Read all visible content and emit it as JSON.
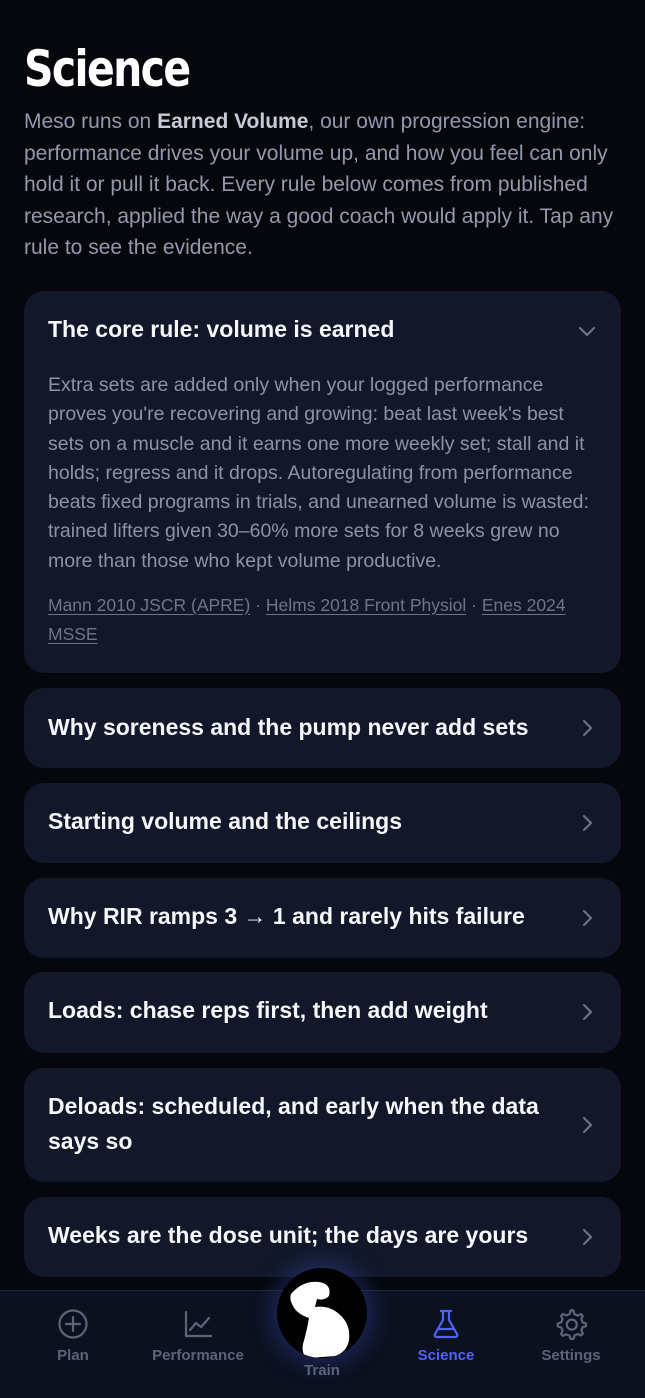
{
  "page": {
    "title": "Science",
    "intro_prefix": "Meso runs on ",
    "intro_bold": "Earned Volume",
    "intro_suffix": ", our own progression engine: performance drives your volume up, and how you feel can only hold it or pull it back. Every rule below comes from published research, applied the way a good coach would apply it. Tap any rule to see the evidence."
  },
  "core_rule": {
    "title": "The core rule: volume is earned",
    "expanded": true,
    "body": "Extra sets are added only when your logged performance proves you're recovering and growing: beat last week's best sets on a muscle and it earns one more weekly set; stall and it holds; regress and it drops. Autoregulating from performance beats fixed programs in trials, and unearned volume is wasted: trained lifters given 30–60% more sets for 8 weeks grew no more than those who kept volume productive.",
    "refs": [
      "Mann 2010 JSCR (APRE)",
      "Helms 2018 Front Physiol",
      "Enes 2024 MSSE"
    ],
    "ref_separator": "·"
  },
  "rules": [
    {
      "title": "Why soreness and the pump never add sets"
    },
    {
      "title": "Starting volume and the ceilings"
    },
    {
      "title": "Why RIR ramps 3 → 1 and rarely hits failure"
    },
    {
      "title": "Loads: chase reps first, then add weight"
    },
    {
      "title": "Deloads: scheduled, and early when the data says so"
    },
    {
      "title": "Weeks are the dose unit; the days are yours"
    }
  ],
  "nav": {
    "items": [
      {
        "label": "Plan",
        "icon": "plus-circle-icon",
        "active": false
      },
      {
        "label": "Performance",
        "icon": "line-chart-icon",
        "active": false
      },
      {
        "label": "Train",
        "icon": "flexed-arm-icon",
        "active": false
      },
      {
        "label": "Science",
        "icon": "flask-icon",
        "active": true
      },
      {
        "label": "Settings",
        "icon": "gear-icon",
        "active": false
      }
    ]
  },
  "colors": {
    "background": "#05070d",
    "card": "#121829",
    "nav": "#0c1120",
    "accent": "#4f63f6",
    "muted_text": "#8d93a5"
  }
}
